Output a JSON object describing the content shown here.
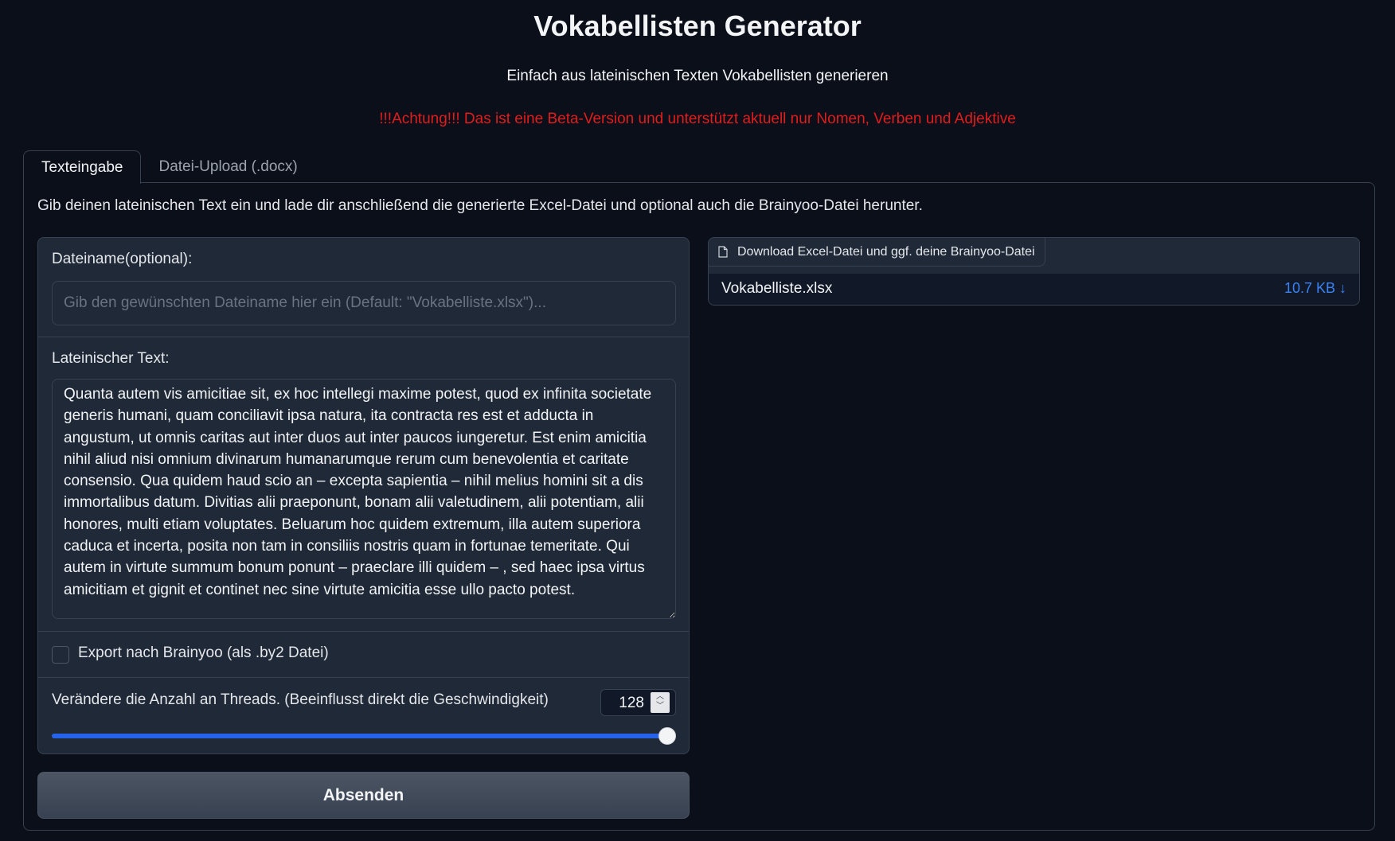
{
  "header": {
    "title": "Vokabellisten Generator",
    "subtitle": "Einfach aus lateinischen Texten Vokabellisten generieren",
    "warning": "!!!Achtung!!! Das ist eine Beta-Version und unterstützt aktuell nur Nomen, Verben und Adjektive"
  },
  "tabs": [
    {
      "label": "Texteingabe",
      "active": true
    },
    {
      "label": "Datei-Upload (.docx)",
      "active": false
    }
  ],
  "panel": {
    "description": "Gib deinen lateinischen Text ein und lade dir anschließend die generierte Excel-Datei und optional auch die Brainyoo-Datei herunter."
  },
  "form": {
    "filename_label": "Dateiname(optional):",
    "filename_placeholder": "Gib den gewünschten Dateiname hier ein (Default: \"Vokabelliste.xlsx\")...",
    "filename_value": "",
    "text_label": "Lateinischer Text:",
    "text_value": "Quanta autem vis amicitiae sit, ex hoc intellegi maxime potest, quod ex infinita societate generis humani, quam conciliavit ipsa natura, ita contracta res est et adducta in angustum, ut omnis caritas aut inter duos aut inter paucos iungeretur. Est enim amicitia nihil aliud nisi omnium divinarum humanarumque rerum cum benevolentia et caritate consensio. Qua quidem haud scio an – excepta sapientia – nihil melius homini sit a dis immortalibus datum. Divitias alii praeponunt, bonam alii valetudinem, alii potentiam, alii honores, multi etiam voluptates. Beluarum hoc quidem extremum, illa autem superiora caduca et incerta, posita non tam in consiliis nostris quam in fortunae temeritate. Qui autem in virtute summum bonum ponunt – praeclare illi quidem – , sed haec ipsa virtus amicitiam et gignit et continet nec sine virtute amicitia esse ullo pacto potest.",
    "export_label": "Export nach Brainyoo (als .by2 Datei)",
    "export_checked": false,
    "threads_label": "Verändere die Anzahl an Threads. (Beeinflusst direkt die Geschwindigkeit)",
    "threads_value": "128",
    "threads_slider_fraction": 1.0,
    "submit_label": "Absenden"
  },
  "download": {
    "header_label": "Download Excel-Datei und ggf. deine Brainyoo-Datei",
    "file_name": "Vokabelliste.xlsx",
    "file_size": "10.7 KB ↓"
  },
  "colors": {
    "background": "#0b0f19",
    "panel": "#1f2937",
    "warning": "#e11d1d",
    "accent": "#2563eb",
    "link": "#3b82f6"
  }
}
